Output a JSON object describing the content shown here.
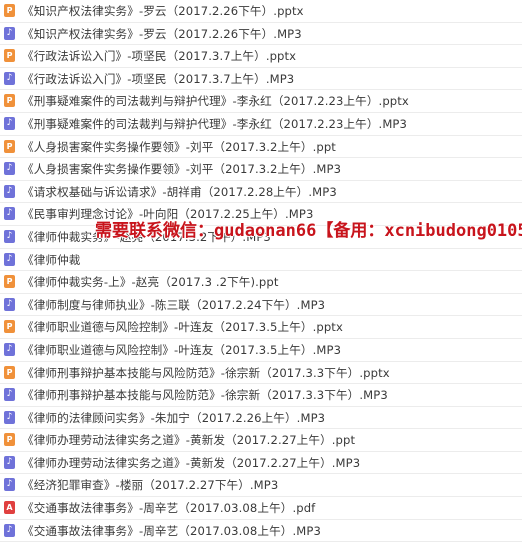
{
  "files": [
    {
      "type": "ppt",
      "name": "《知识产权法律实务》-罗云（2017.2.26下午）.pptx"
    },
    {
      "type": "mp3",
      "name": "《知识产权法律实务》-罗云（2017.2.26下午）.MP3"
    },
    {
      "type": "ppt",
      "name": "《行政法诉讼入门》-项坚民（2017.3.7上午）.pptx"
    },
    {
      "type": "mp3",
      "name": "《行政法诉讼入门》-项坚民（2017.3.7上午）.MP3"
    },
    {
      "type": "ppt",
      "name": "《刑事疑难案件的司法裁判与辩护代理》-李永红（2017.2.23上午）.pptx"
    },
    {
      "type": "mp3",
      "name": "《刑事疑难案件的司法裁判与辩护代理》-李永红（2017.2.23上午）.MP3"
    },
    {
      "type": "ppt",
      "name": "《人身损害案件实务操作要领》-刘平（2017.3.2上午）.ppt"
    },
    {
      "type": "mp3",
      "name": "《人身损害案件实务操作要领》-刘平（2017.3.2上午）.MP3"
    },
    {
      "type": "mp3",
      "name": "《请求权基础与诉讼请求》-胡祥甫（2017.2.28上午）.MP3"
    },
    {
      "type": "mp3",
      "name": "《民事审判理念讨论》-叶向阳（2017.2.25上午）.MP3"
    },
    {
      "type": "mp3",
      "name": "《律师仲裁实务》-赵亮（2017.3.2下午）.MP3"
    },
    {
      "type": "mp3",
      "name": "《律师仲裁"
    },
    {
      "type": "ppt",
      "name": "《律师仲裁实务-上》-赵亮（2017.3 .2下午).ppt"
    },
    {
      "type": "mp3",
      "name": "《律师制度与律师执业》-陈三联（2017.2.24下午）.MP3"
    },
    {
      "type": "ppt",
      "name": "《律师职业道德与风险控制》-叶连友（2017.3.5上午）.pptx"
    },
    {
      "type": "mp3",
      "name": "《律师职业道德与风险控制》-叶连友（2017.3.5上午）.MP3"
    },
    {
      "type": "ppt",
      "name": "《律师刑事辩护基本技能与风险防范》-徐宗新（2017.3.3下午）.pptx"
    },
    {
      "type": "mp3",
      "name": "《律师刑事辩护基本技能与风险防范》-徐宗新（2017.3.3下午）.MP3"
    },
    {
      "type": "mp3",
      "name": "《律师的法律顾问实务》-朱加宁（2017.2.26上午）.MP3"
    },
    {
      "type": "ppt",
      "name": "《律师办理劳动法律实务之道》-黄新发（2017.2.27上午）.ppt"
    },
    {
      "type": "mp3",
      "name": "《律师办理劳动法律实务之道》-黄新发（2017.2.27上午）.MP3"
    },
    {
      "type": "mp3",
      "name": "《经济犯罪审查》-楼丽（2017.2.27下午）.MP3"
    },
    {
      "type": "pdf",
      "name": "《交通事故法律事务》-周辛艺（2017.03.08上午）.pdf"
    },
    {
      "type": "mp3",
      "name": "《交通事故法律事务》-周辛艺（2017.03.08上午）.MP3"
    }
  ],
  "icon_glyphs": {
    "ppt": "P",
    "mp3": "♪",
    "pdf": "A"
  },
  "icon_names": {
    "ppt": "ppt-file-icon",
    "mp3": "audio-file-icon",
    "pdf": "pdf-file-icon"
  },
  "overlay_text": "需要联系微信：gudaonan66【备用：xcnibudong0105】",
  "colors": {
    "ppt": "#f0913a",
    "mp3": "#6f72d9",
    "pdf": "#e0403f",
    "overlay": "#c8141c"
  }
}
